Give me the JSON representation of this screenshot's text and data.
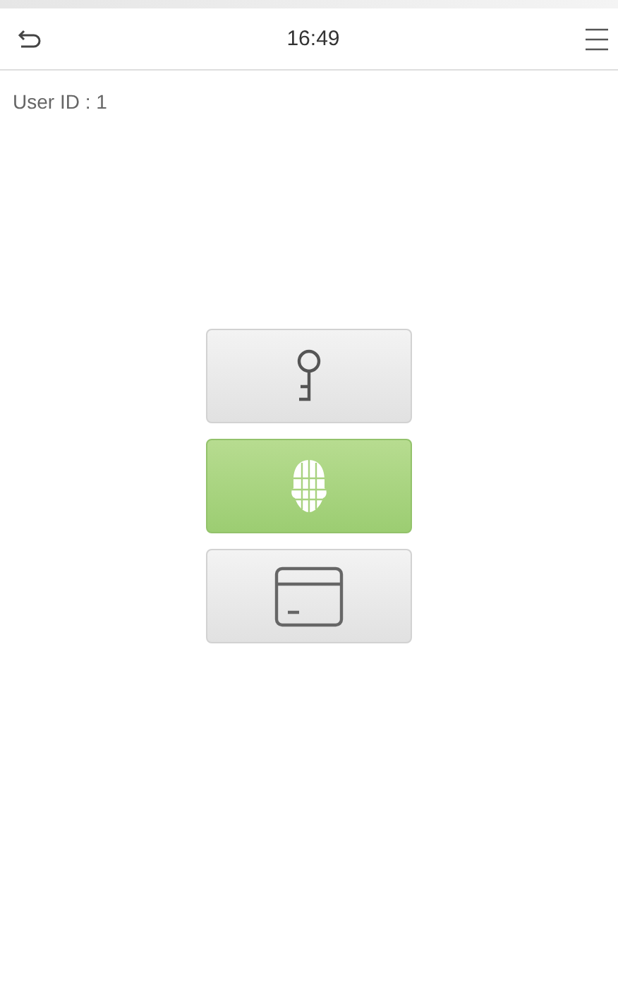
{
  "header": {
    "time": "16:49"
  },
  "user_label": "User ID : 1",
  "methods": [
    {
      "kind": "password",
      "selected": false
    },
    {
      "kind": "face",
      "selected": true
    },
    {
      "kind": "card",
      "selected": false
    }
  ]
}
